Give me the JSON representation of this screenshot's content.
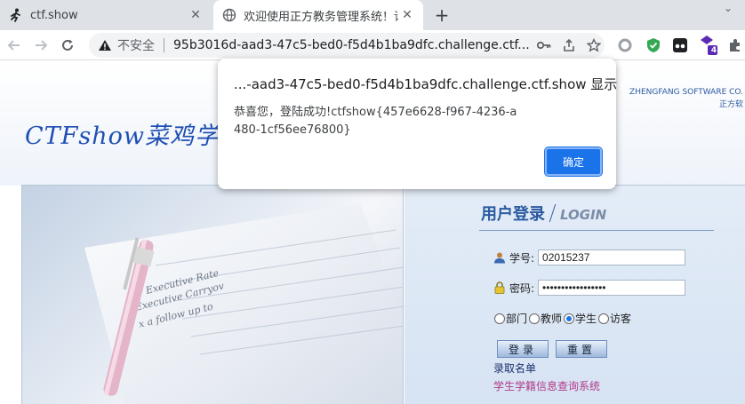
{
  "browser": {
    "tabs": [
      {
        "title": "ctf.show",
        "icon": "runner-icon"
      },
      {
        "title": "欢迎使用正方教务管理系统！请",
        "icon": "globe-icon",
        "active": true
      }
    ],
    "new_tab_symbol": "+",
    "close_symbol": "✕",
    "address": {
      "security_label": "不安全",
      "url": "95b3016d-aad3-47c5-bed0-f5d4b1ba9dfc.challenge.ctf...."
    },
    "extension_badge": "4"
  },
  "dialog": {
    "title": "...-aad3-47c5-bed0-f5d4b1ba9dfc.challenge.ctf.show 显示",
    "message": "恭喜您，登陆成功!ctfshow{457e6628-f967-4236-a480-1cf56ee76800}",
    "ok_label": "确定"
  },
  "page": {
    "logo_text": "CTFshow菜鸡学",
    "company_line1": "ZHENGFANG SOFTWARE CO.",
    "company_line2": "正方软",
    "login": {
      "heading_cn": "用户登录",
      "heading_en": "LOGIN",
      "student_id_label": "学号:",
      "student_id_value": "02015237",
      "password_label": "密码:",
      "password_value": "•••••••••••••••••",
      "roles": [
        {
          "label": "部门",
          "checked": false
        },
        {
          "label": "教师",
          "checked": false
        },
        {
          "label": "学生",
          "checked": true
        },
        {
          "label": "访客",
          "checked": false
        }
      ],
      "login_button": "登录",
      "reset_button": "重置",
      "link1": "录取名单",
      "link2": "学生学籍信息查询系统"
    },
    "photo_texts": [
      "Executive Rate",
      "Executive Carryov",
      "x a follow up to"
    ]
  },
  "colors": {
    "accent": "#1a73e8",
    "brand_blue": "#2a5aa0",
    "link_purple": "#b03a8a",
    "link_dark": "#1b2f70"
  }
}
